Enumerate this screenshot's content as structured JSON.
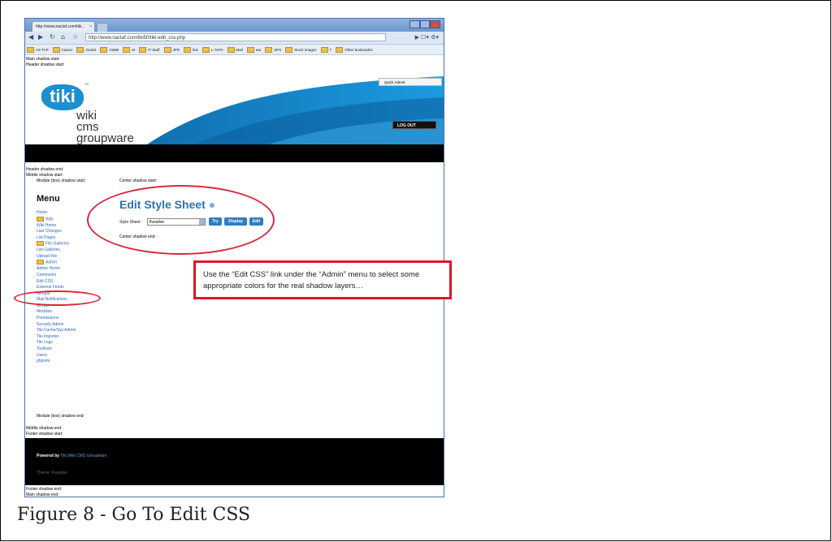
{
  "caption": "Figure 8 - Go To Edit CSS",
  "browser": {
    "tab_title": "http://www.nactaf.com/tiki...",
    "tab_close": "×",
    "url": "http://www.nactaf.com/tiki50/tiki-edit_css.php",
    "bookmarks": [
      "AZ-TAP",
      "Career",
      "GLWS",
      "GWBI",
      "M",
      "IT-Stuff",
      "JPR",
      "link",
      "L-TAPs",
      "Mail",
      "ww",
      "SPS",
      "Stock Images",
      "T",
      "Other bookmarks"
    ]
  },
  "debug": {
    "main_start": "Main shadow start:",
    "header_start": "Header shadow start:",
    "header_end": "Header shadow end:",
    "middle_start": "Middle shadow start:",
    "module_start": "Module (box) shadow start:",
    "center_start": "Center shadow start:",
    "center_end": "Center shadow end:",
    "module_end": "Module (box) shadow end:",
    "middle_end": "Middle shadow end:",
    "footer_start": "Footer shadow start:",
    "footer_end": "Footer shadow end:",
    "main_end": "Main shadow end:"
  },
  "header": {
    "logo_text": "tiki",
    "tm": "TM",
    "wiki_lines": [
      "wiki",
      "cms",
      "groupware"
    ],
    "quick_admin": "Quick Admin:",
    "logout": "LOG OUT"
  },
  "menu": {
    "title": "Menu",
    "items": [
      {
        "label": "Home",
        "folder": false
      },
      {
        "label": "Wiki",
        "folder": true
      },
      {
        "label": "Wiki Home",
        "folder": false
      },
      {
        "label": "Last Changes",
        "folder": false
      },
      {
        "label": "List Pages",
        "folder": false
      },
      {
        "label": "File Galleries",
        "folder": true
      },
      {
        "label": "List Galleries",
        "folder": false
      },
      {
        "label": "Upload File",
        "folder": false
      },
      {
        "label": "Admin",
        "folder": true
      },
      {
        "label": "Admin Home",
        "folder": false
      },
      {
        "label": "Comments",
        "folder": false
      },
      {
        "label": "Edit CSS",
        "folder": false
      },
      {
        "label": "External Feeds",
        "folder": false
      },
      {
        "label": "Groups",
        "folder": false
      },
      {
        "label": "Mail Notifications",
        "folder": false
      },
      {
        "label": "Menus",
        "folder": false
      },
      {
        "label": "Modules",
        "folder": false
      },
      {
        "label": "Permissions",
        "folder": false
      },
      {
        "label": "Security Admin",
        "folder": false
      },
      {
        "label": "Tiki Cache/Sys Admin",
        "folder": false
      },
      {
        "label": "Tiki Importer",
        "folder": false
      },
      {
        "label": "Tiki Logs",
        "folder": false
      },
      {
        "label": "Toolbars",
        "folder": false
      },
      {
        "label": "Users",
        "folder": false
      },
      {
        "label": "phpinfo",
        "folder": false
      }
    ]
  },
  "edit_css": {
    "title": "Edit Style Sheet",
    "style_sheet_label": "Style Sheet :",
    "style_sheet_value": "fivealive",
    "btn_try": "Try",
    "btn_display": "Display",
    "btn_edit": "Edit"
  },
  "footer": {
    "powered_by": "Powered by",
    "powered_link": "Tiki Wiki CMS Groupware",
    "theme": "Theme: Fivealive"
  },
  "callout_text": "Use the “Edit CSS” link under the “Admin” menu to select some appropriate colors for the real shadow layers…",
  "colors": {
    "accent": "#2a73b8",
    "callout_border": "#e0142a",
    "ring": "#d8283a"
  }
}
